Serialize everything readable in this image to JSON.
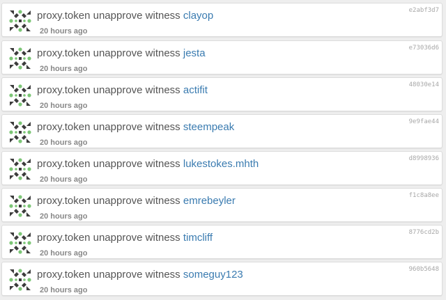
{
  "colors": {
    "link": "#3a7bb0",
    "text": "#555555",
    "meta": "#888888",
    "avatar_dark": "#3c3c3c",
    "avatar_green": "#7cc576"
  },
  "icon": "identicon-avatar",
  "operations": [
    {
      "actor": "proxy.token",
      "action": "unapprove witness",
      "target": "clayop",
      "time": "20 hours ago",
      "hash": "e2abf3d7"
    },
    {
      "actor": "proxy.token",
      "action": "unapprove witness",
      "target": "jesta",
      "time": "20 hours ago",
      "hash": "e73036d6"
    },
    {
      "actor": "proxy.token",
      "action": "unapprove witness",
      "target": "actifit",
      "time": "20 hours ago",
      "hash": "48030e14"
    },
    {
      "actor": "proxy.token",
      "action": "unapprove witness",
      "target": "steempeak",
      "time": "20 hours ago",
      "hash": "9e9fae44"
    },
    {
      "actor": "proxy.token",
      "action": "unapprove witness",
      "target": "lukestokes.mhth",
      "time": "20 hours ago",
      "hash": "d8998936"
    },
    {
      "actor": "proxy.token",
      "action": "unapprove witness",
      "target": "emrebeyler",
      "time": "20 hours ago",
      "hash": "f1c8a8ee"
    },
    {
      "actor": "proxy.token",
      "action": "unapprove witness",
      "target": "timcliff",
      "time": "20 hours ago",
      "hash": "8776cd2b"
    },
    {
      "actor": "proxy.token",
      "action": "unapprove witness",
      "target": "someguy123",
      "time": "20 hours ago",
      "hash": "960b5648"
    }
  ]
}
